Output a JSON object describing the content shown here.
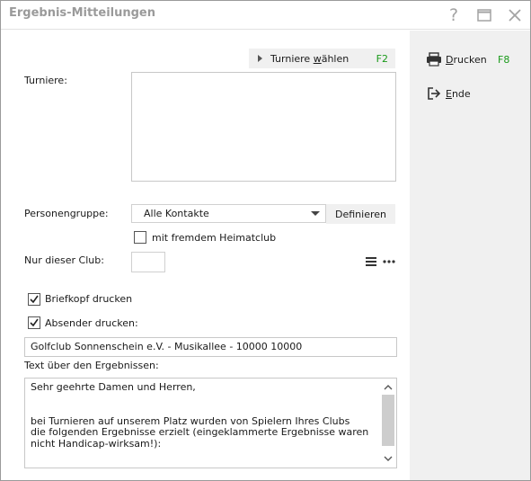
{
  "window": {
    "title": "Ergebnis-Mitteilungen",
    "help_glyph": "?"
  },
  "tournaments": {
    "select_button_label_pre": "Turniere ",
    "select_button_label_mnemonic": "w",
    "select_button_label_post": "ählen",
    "select_button_key": "F2",
    "label": "Turniere:"
  },
  "person_group": {
    "label": "Personengruppe:",
    "value": "Alle Kontakte",
    "define_label": "Definieren"
  },
  "foreign_club": {
    "label": "mit fremdem Heimatclub",
    "checked": false
  },
  "club": {
    "label": "Nur dieser Club:",
    "value": ""
  },
  "letterhead": {
    "label": "Briefkopf drucken",
    "checked": true
  },
  "sender": {
    "label": "Absender drucken:",
    "checked": true,
    "value": "Golfclub Sonnenschein e.V. - Musikallee - 10000 10000"
  },
  "text_above": {
    "label": "Text über den Ergebnissen:",
    "value": "Sehr geehrte Damen und Herren,\n\n\nbei Turnieren auf unserem Platz wurden von Spielern Ihres Clubs\ndie folgenden Ergebnisse erzielt (eingeklammerte Ergebnisse waren\nnicht Handicap-wirksam!):"
  },
  "sidebar": {
    "print_mnemonic": "D",
    "print_rest": "rucken",
    "print_key": "F8",
    "end_mnemonic": "E",
    "end_rest": "nde"
  },
  "colors": {
    "accent_key": "#1a9a1a",
    "panel": "#f0f0f0"
  }
}
